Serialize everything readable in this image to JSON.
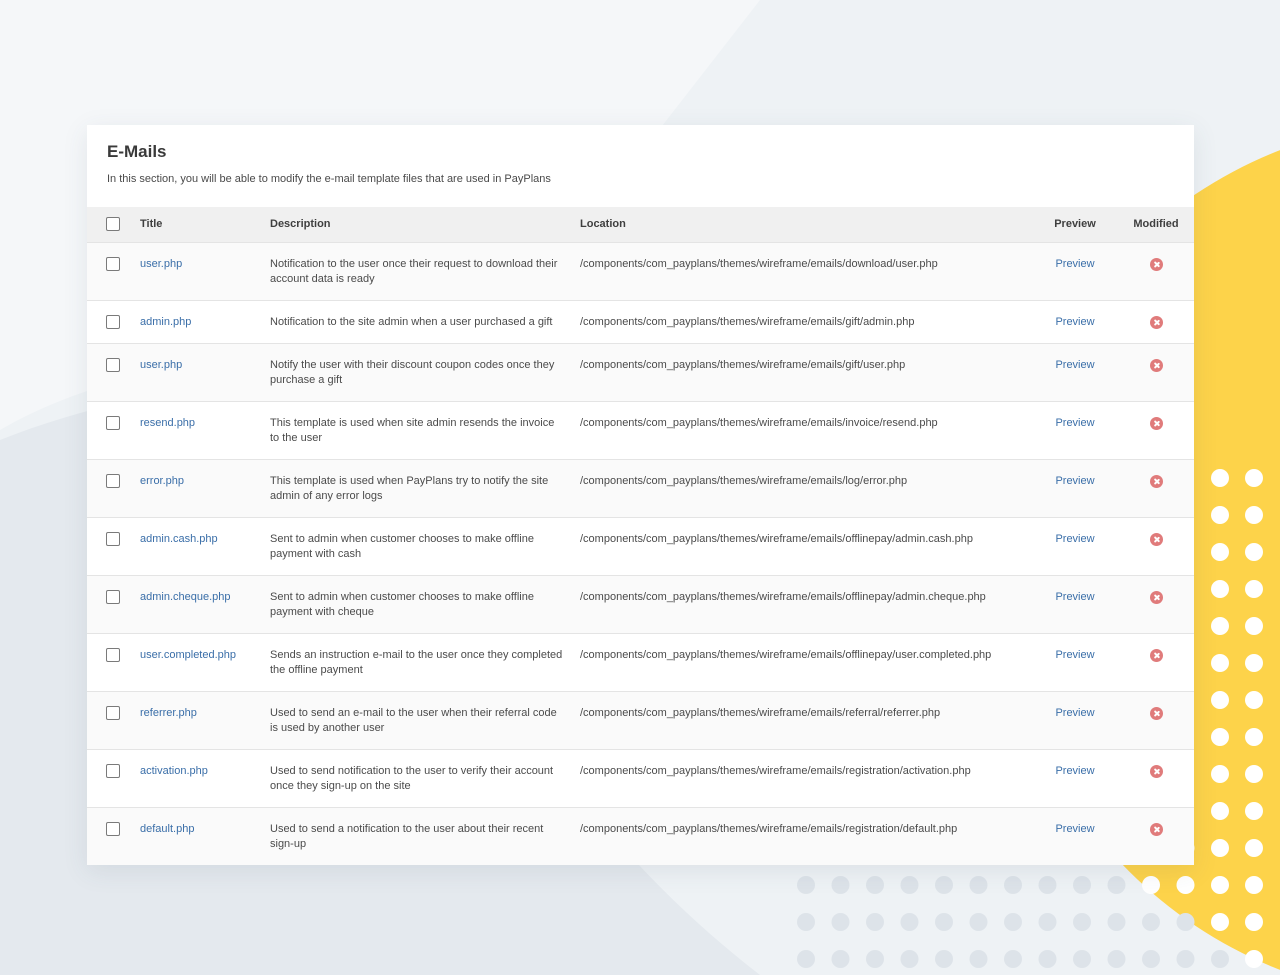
{
  "page": {
    "title": "E-Mails",
    "description": "In this section, you will be able to modify the e-mail template files that are used in PayPlans"
  },
  "colors": {
    "accent_yellow": "#fdd34a",
    "link": "#3a6ea8",
    "modified_icon": "#e07b7b"
  },
  "table": {
    "headers": {
      "title": "Title",
      "description": "Description",
      "location": "Location",
      "preview": "Preview",
      "modified": "Modified"
    },
    "rows": [
      {
        "title": "user.php",
        "description": "Notification to the user once their request to download their account data is ready",
        "location": "/components/com_payplans/themes/wireframe/emails/download/user.php",
        "preview": "Preview",
        "modified_icon": "close-circle-icon"
      },
      {
        "title": "admin.php",
        "description": "Notification to the site admin when a user purchased a gift",
        "location": "/components/com_payplans/themes/wireframe/emails/gift/admin.php",
        "preview": "Preview",
        "modified_icon": "close-circle-icon"
      },
      {
        "title": "user.php",
        "description": "Notify the user with their discount coupon codes once they purchase a gift",
        "location": "/components/com_payplans/themes/wireframe/emails/gift/user.php",
        "preview": "Preview",
        "modified_icon": "close-circle-icon"
      },
      {
        "title": "resend.php",
        "description": "This template is used when site admin resends the invoice to the user",
        "location": "/components/com_payplans/themes/wireframe/emails/invoice/resend.php",
        "preview": "Preview",
        "modified_icon": "close-circle-icon"
      },
      {
        "title": "error.php",
        "description": "This template is used when PayPlans try to notify the site admin of any error logs",
        "location": "/components/com_payplans/themes/wireframe/emails/log/error.php",
        "preview": "Preview",
        "modified_icon": "close-circle-icon"
      },
      {
        "title": "admin.cash.php",
        "description": "Sent to admin when customer chooses to make offline payment with cash",
        "location": "/components/com_payplans/themes/wireframe/emails/offlinepay/admin.cash.php",
        "preview": "Preview",
        "modified_icon": "close-circle-icon"
      },
      {
        "title": "admin.cheque.php",
        "description": "Sent to admin when customer chooses to make offline payment with cheque",
        "location": "/components/com_payplans/themes/wireframe/emails/offlinepay/admin.cheque.php",
        "preview": "Preview",
        "modified_icon": "close-circle-icon"
      },
      {
        "title": "user.completed.php",
        "description": "Sends an instruction e-mail to the user once they completed the offline payment",
        "location": "/components/com_payplans/themes/wireframe/emails/offlinepay/user.completed.php",
        "preview": "Preview",
        "modified_icon": "close-circle-icon"
      },
      {
        "title": "referrer.php",
        "description": "Used to send an e-mail to the user when their referral code is used by another user",
        "location": "/components/com_payplans/themes/wireframe/emails/referral/referrer.php",
        "preview": "Preview",
        "modified_icon": "close-circle-icon"
      },
      {
        "title": "activation.php",
        "description": "Used to send notification to the user to verify their account once they sign-up on the site",
        "location": "/components/com_payplans/themes/wireframe/emails/registration/activation.php",
        "preview": "Preview",
        "modified_icon": "close-circle-icon"
      },
      {
        "title": "default.php",
        "description": "Used to send a notification to the user about their recent sign-up",
        "location": "/components/com_payplans/themes/wireframe/emails/registration/default.php",
        "preview": "Preview",
        "modified_icon": "close-circle-icon"
      }
    ]
  }
}
